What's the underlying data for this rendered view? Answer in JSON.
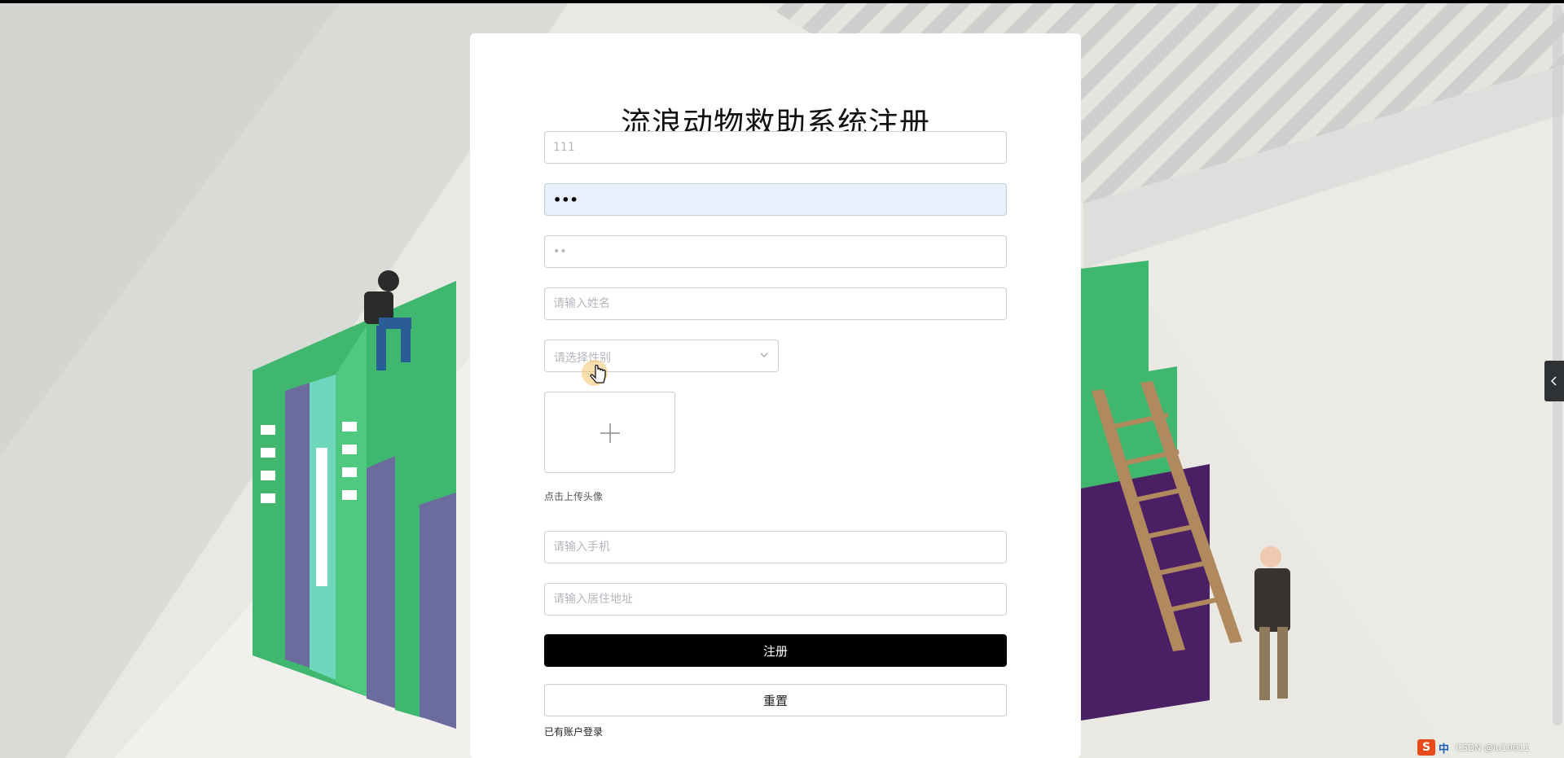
{
  "page": {
    "title": "流浪动物救助系统注册"
  },
  "form": {
    "username": {
      "value": "111",
      "placeholder": ""
    },
    "password": {
      "value": "•••",
      "placeholder": ""
    },
    "confirm_password": {
      "value": "••",
      "placeholder": ""
    },
    "name": {
      "value": "",
      "placeholder": "请输入姓名"
    },
    "gender": {
      "placeholder": "请选择性别",
      "selected": ""
    },
    "avatar": {
      "hint": "点击上传头像"
    },
    "phone": {
      "value": "",
      "placeholder": "请输入手机"
    },
    "address": {
      "value": "",
      "placeholder": "请输入居住地址"
    },
    "submit_label": "注册",
    "reset_label": "重置",
    "login_link": "已有账户登录"
  },
  "taskbar": {
    "ime_logo": "S",
    "ime_lang": "中",
    "watermark": "CSDN @lu10611"
  },
  "colors": {
    "accent": "#000000",
    "autofill_bg": "#e8f0fe",
    "border": "#c9ccd3",
    "placeholder": "#b4b7bd",
    "book_green": "#3fb76f",
    "book_purple": "#6c6b9e",
    "book_dark_purple": "#4a1f64"
  },
  "icons": [
    "chevron-down-icon",
    "plus-icon",
    "hand-cursor-icon",
    "chevron-left-icon"
  ]
}
